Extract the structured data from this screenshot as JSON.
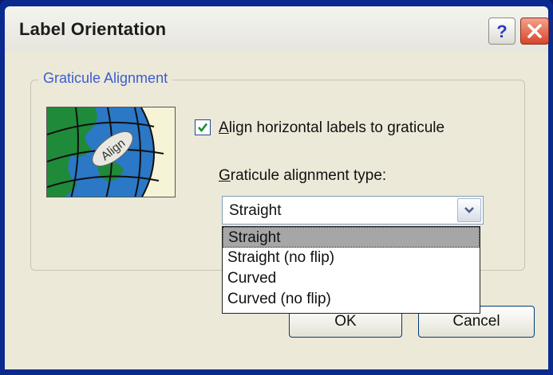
{
  "window": {
    "title": "Label Orientation",
    "help_label": "?"
  },
  "group": {
    "label": "Graticule Alignment"
  },
  "thumbnail": {
    "badge_text": "Align"
  },
  "checkbox": {
    "label_accel": "A",
    "label_rest": "lign horizontal labels to graticule",
    "checked": true
  },
  "combo": {
    "label_accel": "G",
    "label_rest": "raticule alignment type:",
    "value": "Straight",
    "options": [
      "Straight",
      "Straight (no flip)",
      "Curved",
      "Curved (no flip)"
    ],
    "selected_index": 0
  },
  "buttons": {
    "ok_label": "OK",
    "cancel_label": "Cancel"
  },
  "colors": {
    "accent": "#3c5cd0",
    "titlebar_frame": "#0b2a8f",
    "close": "#d8452a"
  }
}
